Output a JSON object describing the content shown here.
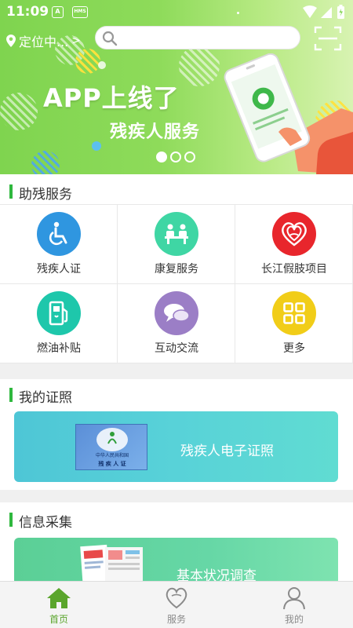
{
  "status_bar": {
    "time": "11:09",
    "badge1": "A",
    "badge2": "HMS"
  },
  "top_bar": {
    "location_label": "定位中...",
    "search_placeholder": ""
  },
  "banner": {
    "title": "APP上线了",
    "subtitle": "残疾人服务",
    "slide_count": 3,
    "active_slide": 1
  },
  "services": {
    "title": "助残服务",
    "items": [
      {
        "label": "残疾人证",
        "icon": "wheelchair-icon",
        "color": "#2f96e0"
      },
      {
        "label": "康复服务",
        "icon": "rehab-desk-icon",
        "color": "#3fd6a4"
      },
      {
        "label": "长江假肢项目",
        "icon": "heart-hand-icon",
        "color": "#e8262c"
      },
      {
        "label": "燃油补贴",
        "icon": "fuel-pump-icon",
        "color": "#1ec7ab"
      },
      {
        "label": "互动交流",
        "icon": "chat-bubbles-icon",
        "color": "#9b7ec6"
      },
      {
        "label": "更多",
        "icon": "grid-more-icon",
        "color": "#f1cd18"
      }
    ]
  },
  "certificates": {
    "title": "我的证照",
    "card_label": "残疾人电子证照",
    "cert_line1": "中华人民共和国",
    "cert_line2": "残 疾 人 证"
  },
  "info_collection": {
    "title": "信息采集",
    "card_label": "基本状况调查"
  },
  "bottom_nav": {
    "items": [
      {
        "label": "首页",
        "icon": "home-icon",
        "active": true
      },
      {
        "label": "服务",
        "icon": "heart-outline-icon",
        "active": false
      },
      {
        "label": "我的",
        "icon": "person-icon",
        "active": false
      }
    ]
  },
  "colors": {
    "accent_green": "#2fb83e",
    "nav_active": "#5aa52c",
    "nav_inactive": "#8a8a8a"
  }
}
